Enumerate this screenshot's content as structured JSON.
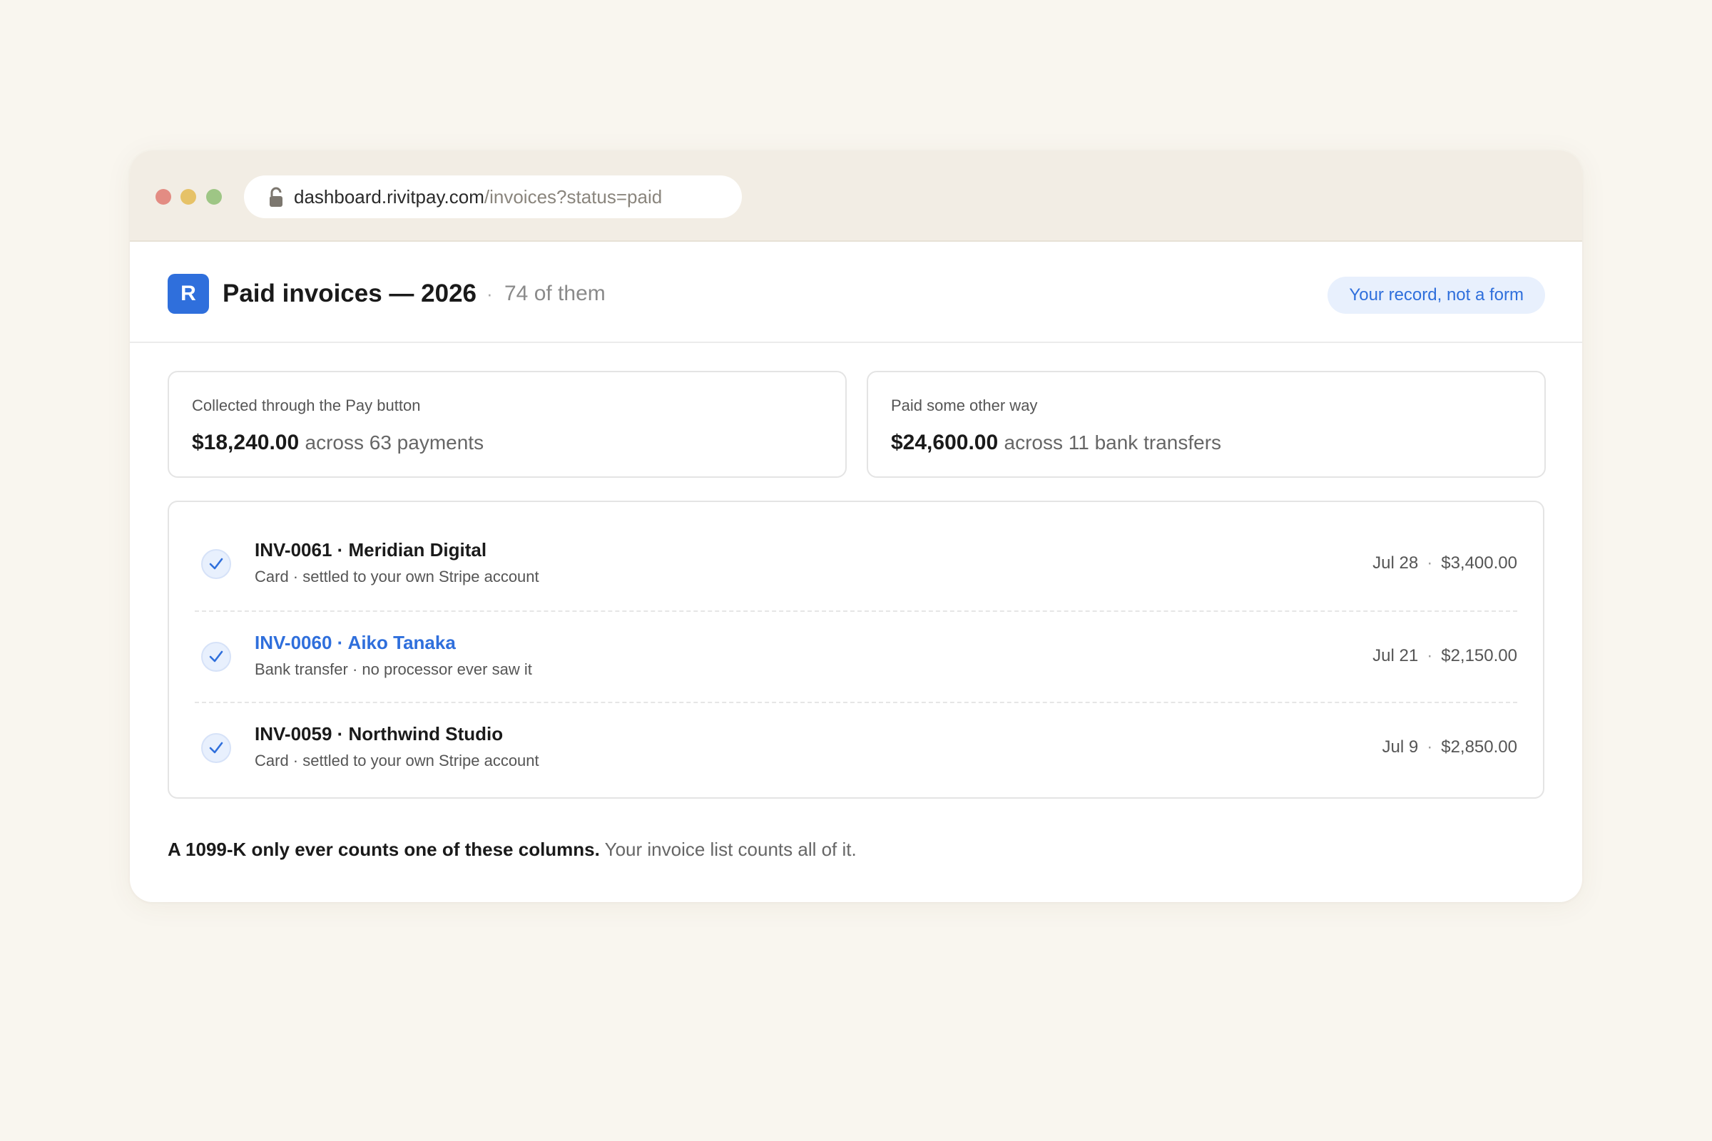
{
  "browser": {
    "url_host": "dashboard.rivitpay.com",
    "url_path": "/invoices?status=paid"
  },
  "header": {
    "logo_letter": "R",
    "title": "Paid invoices — 2026",
    "separator": "·",
    "count": "74 of them",
    "badge": "Your record, not a form"
  },
  "summary": {
    "pay_button": {
      "label": "Collected through the Pay button",
      "amount": "$18,240.00",
      "detail": "across 63 payments"
    },
    "other": {
      "label": "Paid some other way",
      "amount": "$24,600.00",
      "detail": "across 11 bank transfers"
    }
  },
  "invoices": [
    {
      "title": "INV-0061 · Meridian Digital",
      "subtitle": "Card · settled to your own Stripe account",
      "date": "Jul 28",
      "sep": "·",
      "amount": "$3,400.00"
    },
    {
      "title": "INV-0060 · Aiko Tanaka",
      "subtitle": "Bank transfer · no processor ever saw it",
      "date": "Jul 21",
      "sep": "·",
      "amount": "$2,150.00"
    },
    {
      "title": "INV-0059 · Northwind Studio",
      "subtitle": "Card · settled to your own Stripe account",
      "date": "Jul 9",
      "sep": "·",
      "amount": "$2,850.00"
    }
  ],
  "footer": {
    "strong": "A 1099-K only ever counts one of these columns.",
    "rest": " Your invoice list counts all of it."
  },
  "colors": {
    "accent": "#2f6fdc",
    "background": "#f9f6ef",
    "chrome": "#f2ede4"
  },
  "icons": {
    "lock": "lock-icon",
    "check": "check-icon"
  }
}
